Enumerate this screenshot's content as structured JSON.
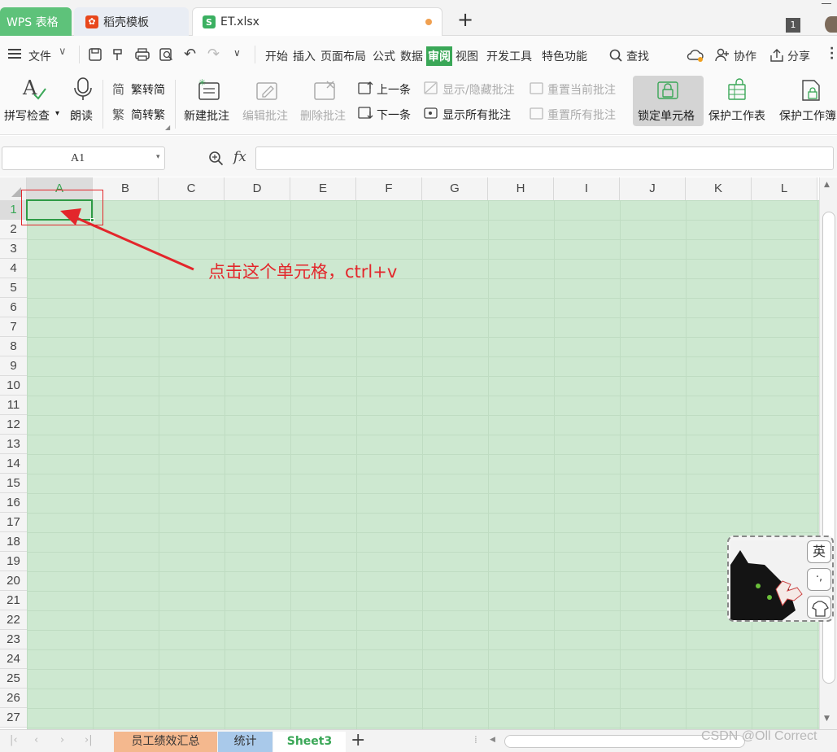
{
  "titlebar": {
    "tabs": [
      {
        "label": "WPS 表格"
      },
      {
        "label": "稻壳模板"
      },
      {
        "label": "ET.xlsx"
      }
    ],
    "badge": "1"
  },
  "menu": {
    "file": "文件",
    "items": [
      "开始",
      "插入",
      "页面布局",
      "公式",
      "数据",
      "审阅",
      "视图",
      "开发工具",
      "特色功能"
    ],
    "active": "审阅",
    "find": "查找",
    "collab": "协作",
    "share": "分享"
  },
  "ribbon": {
    "spell_check": "拼写检查",
    "read_aloud": "朗读",
    "trad_to_simp": "繁转简",
    "simp_to_trad": "简转繁",
    "new_comment": "新建批注",
    "edit_comment": "编辑批注",
    "delete_comment": "删除批注",
    "prev": "上一条",
    "next": "下一条",
    "show_hide_comment": "显示/隐藏批注",
    "show_all_comments": "显示所有批注",
    "reset_current": "重置当前批注",
    "reset_all": "重置所有批注",
    "lock_cell": "锁定单元格",
    "protect_sheet": "保护工作表",
    "protect_book": "保护工作簿"
  },
  "formula_bar": {
    "name_box": "A1",
    "fx": "fx",
    "value": ""
  },
  "grid": {
    "columns": [
      "A",
      "B",
      "C",
      "D",
      "E",
      "F",
      "G",
      "H",
      "I",
      "J",
      "K",
      "L"
    ],
    "rows": [
      "1",
      "2",
      "3",
      "4",
      "5",
      "6",
      "7",
      "8",
      "9",
      "10",
      "11",
      "12",
      "13",
      "14",
      "15",
      "16",
      "17",
      "18",
      "19",
      "20",
      "21",
      "22",
      "23",
      "24",
      "25",
      "26",
      "27"
    ],
    "selected_cell": "A1"
  },
  "annotation": {
    "text": "点击这个单元格，ctrl+v",
    "color": "#e3262b"
  },
  "ime": {
    "lang": "英",
    "punct": "·,"
  },
  "sheets": {
    "tabs": [
      "员工绩效汇总",
      "统计",
      "Sheet3"
    ],
    "active": "Sheet3"
  },
  "watermark": "CSDN @Oll Correct",
  "colors": {
    "wps_green": "#5ec27a",
    "sheet_bg": "#cde8d0",
    "active_menu": "#3aa757",
    "select_border": "#2e9b45"
  }
}
